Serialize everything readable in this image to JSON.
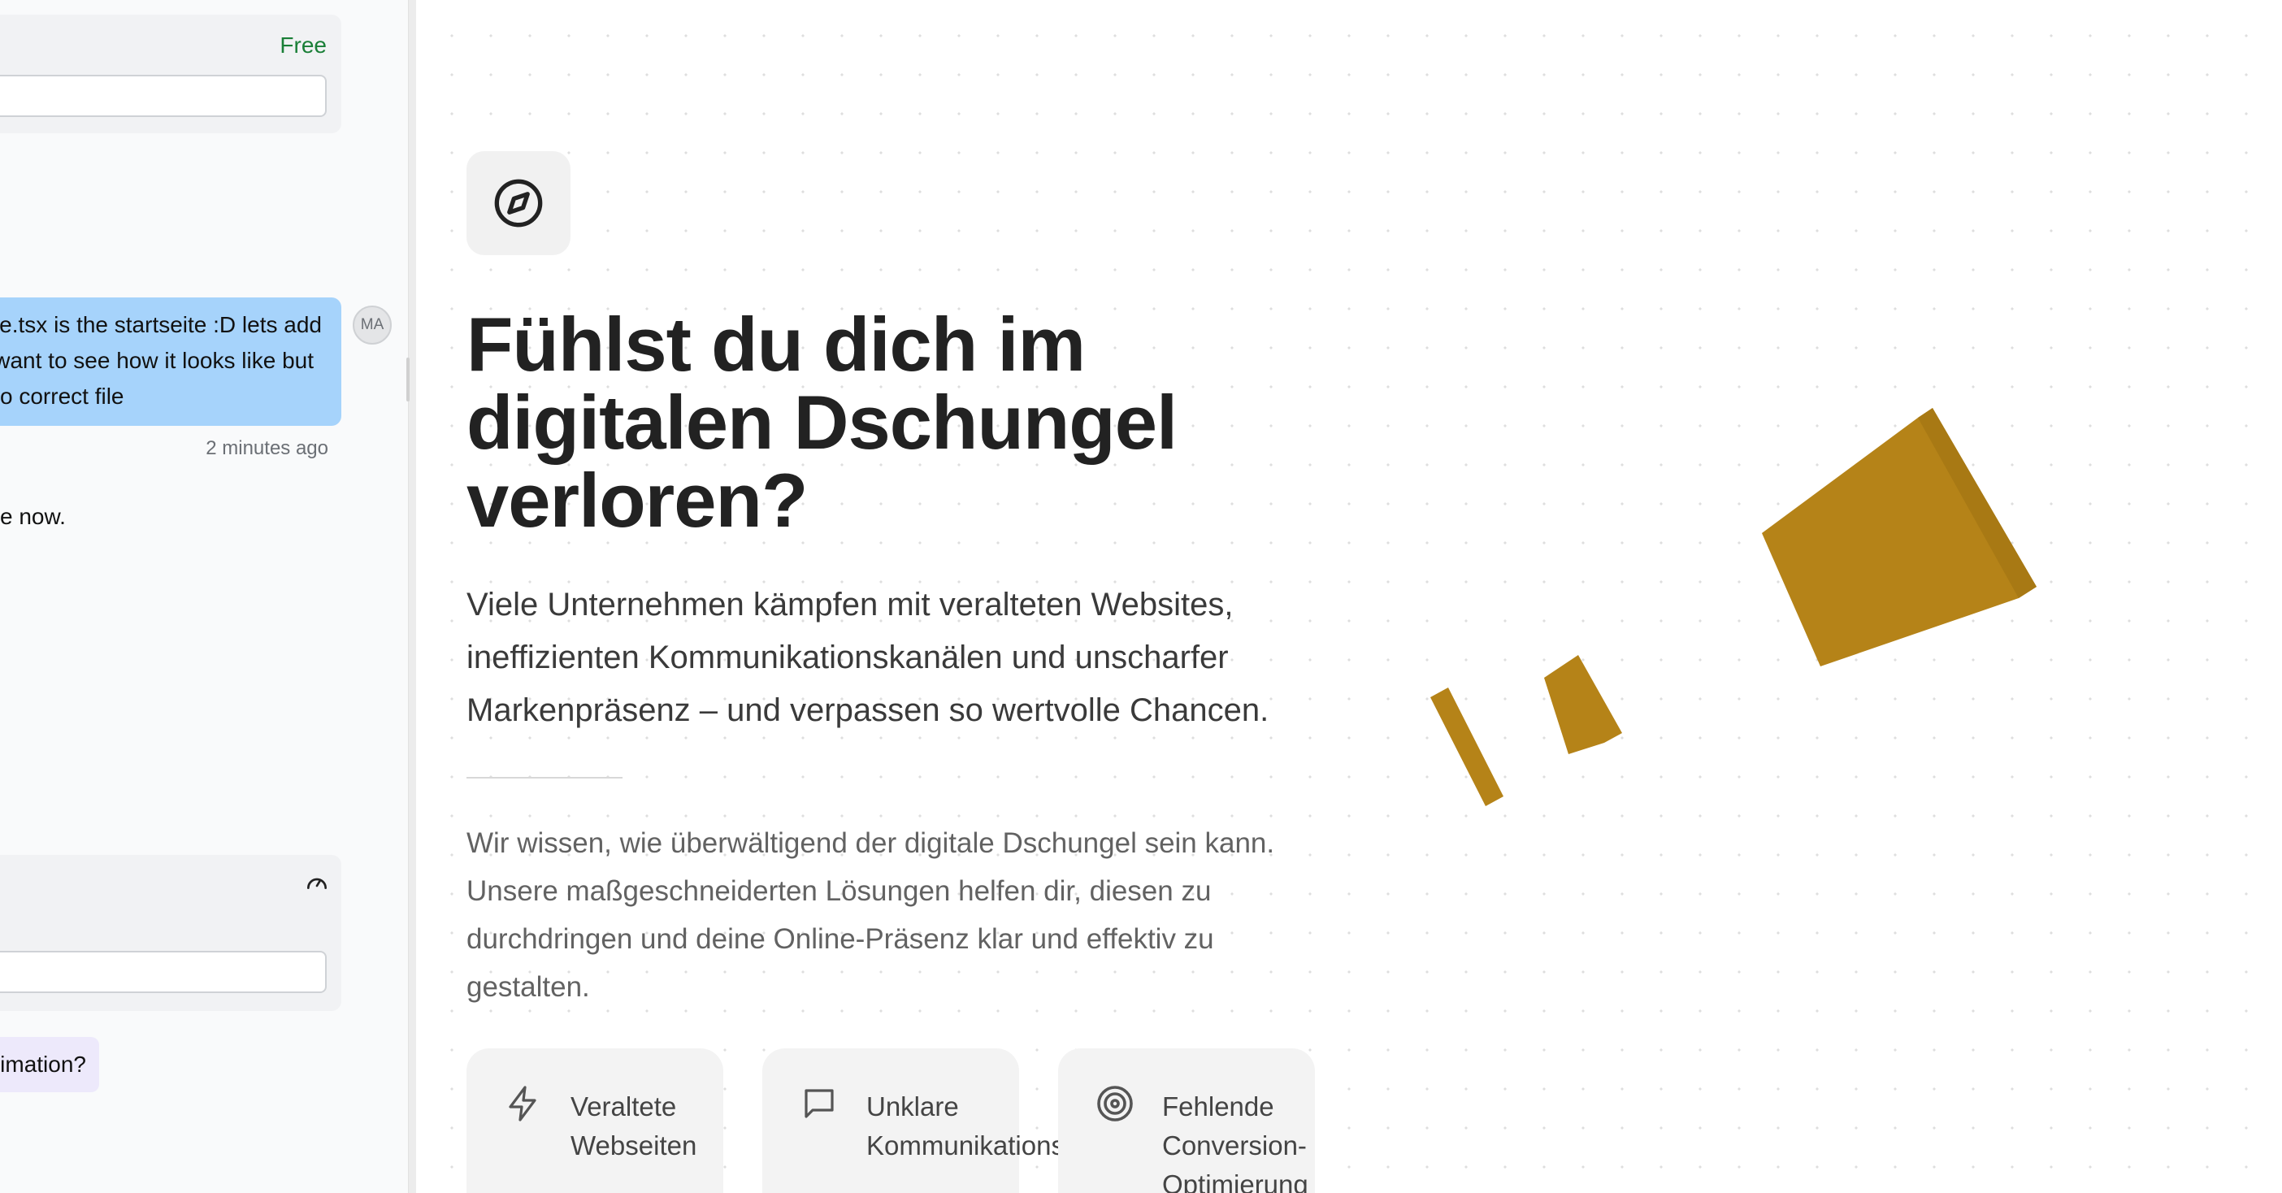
{
  "chat": {
    "plan_badge": "Free",
    "user_message": {
      "line1": "e.tsx is the startseite :D lets add",
      "line2": "want to see how it looks like but",
      "line3": "o correct file"
    },
    "avatar_initials": "MA",
    "timestamp": "2 minutes ago",
    "assistant_snippet": "e now.",
    "suggestion": "imation?"
  },
  "hero": {
    "title": "Fühlst du dich im digitalen Dschungel verloren?",
    "lead": "Viele Unternehmen kämpfen mit veralteten Websites, ineffizienten Kommunikationskanälen und unscharfer Markenpräsenz – und verpassen so wertvolle Chancen.",
    "body": "Wir wissen, wie überwältigend der digitale Dschungel sein kann. Unsere maßgeschneiderten Lösungen helfen dir, diesen zu durchdringen und deine Online-Präsenz klar und effektiv zu gestalten."
  },
  "features": [
    {
      "label": "Veraltete\nWebseiten",
      "icon": "lightning-icon"
    },
    {
      "label": "Unklare\nKommunikationskanäle",
      "icon": "chat-bubble-icon"
    },
    {
      "label": "Fehlende\nConversion-\nOptimierung",
      "icon": "target-icon"
    }
  ],
  "colors": {
    "accent_gold": "#b58318",
    "bubble_blue": "#a6d3fb",
    "badge_green": "#1a7f37"
  }
}
